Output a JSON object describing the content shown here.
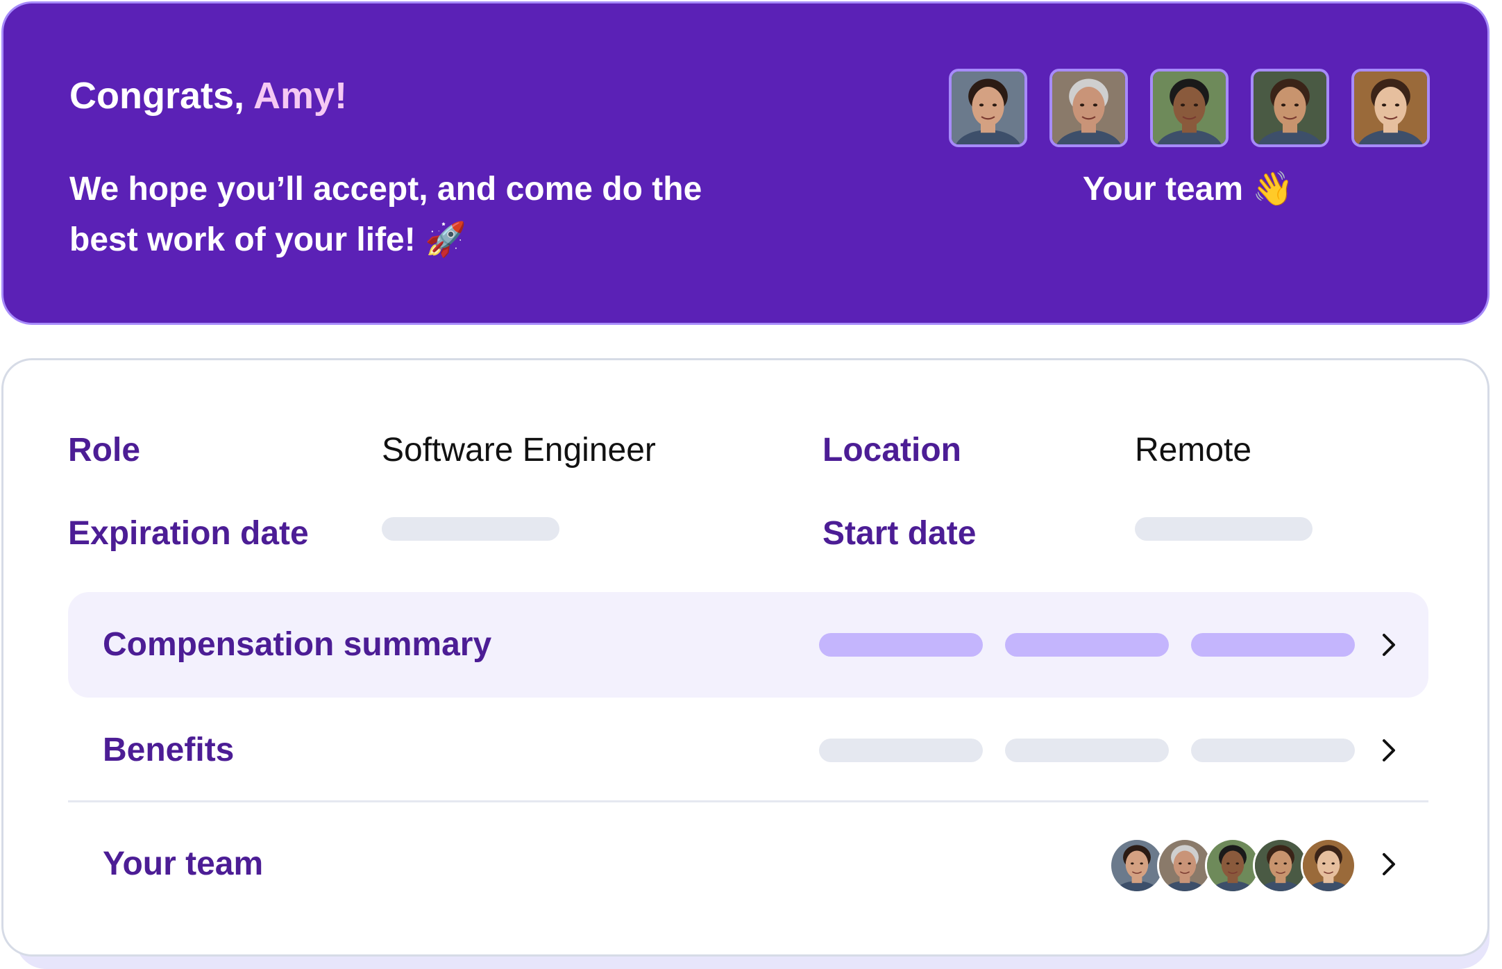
{
  "banner": {
    "greeting": "Congrats, ",
    "name": "Amy!",
    "message": "We hope you’ll accept, and come do the best work of your life!",
    "message_emoji": "🚀",
    "team_caption": "Your team",
    "team_emoji": "👋"
  },
  "team_members": [
    {
      "icon": "avatar-woman-dark-hair",
      "skin": "#d4a182",
      "hair": "#2b1b14",
      "bg": "#6b7a8c"
    },
    {
      "icon": "avatar-man-glasses",
      "skin": "#c99478",
      "hair": "#cfcfcf",
      "bg": "#8a7a6a"
    },
    {
      "icon": "avatar-man-smiling",
      "skin": "#8a5a3c",
      "hair": "#1a1a1a",
      "bg": "#6e8a5a"
    },
    {
      "icon": "avatar-man-short-hair",
      "skin": "#c8946e",
      "hair": "#3a2418",
      "bg": "#4a5a44"
    },
    {
      "icon": "avatar-young-woman",
      "skin": "#e6bf9e",
      "hair": "#3b2418",
      "bg": "#9a6a3a"
    }
  ],
  "offer": {
    "role_label": "Role",
    "role_value": "Software Engineer",
    "location_label": "Location",
    "location_value": "Remote",
    "expiration_label": "Expiration date",
    "start_label": "Start date"
  },
  "sections": {
    "compensation": "Compensation summary",
    "benefits": "Benefits",
    "team": "Your team"
  },
  "colors": {
    "brand": "#5b21b6",
    "accent_text": "#4c1d95",
    "skeleton": "#e5e8f0",
    "skeleton_purple": "#c4b5fd"
  }
}
